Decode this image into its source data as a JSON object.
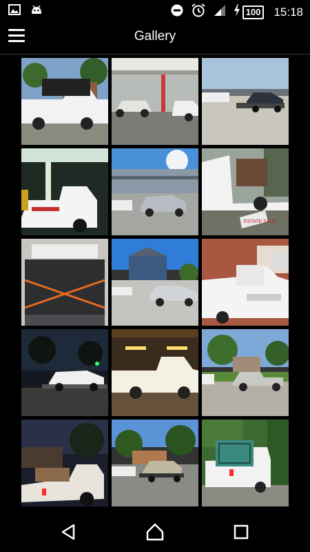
{
  "status_bar": {
    "time": "15:18",
    "battery_level": "100",
    "icons": [
      "image-notification-icon",
      "android-bot-icon",
      "do-not-disturb-icon",
      "alarm-icon",
      "signal-icon",
      "battery-charging-icon"
    ]
  },
  "app_bar": {
    "title": "Gallery",
    "menu_icon": "hamburger-menu-icon"
  },
  "gallery": {
    "columns": 3,
    "photos": [
      {
        "id": "1",
        "subject": "white pickup truck loaded with furniture in driveway"
      },
      {
        "id": "2",
        "subject": "white truck towing car at gas station"
      },
      {
        "id": "3",
        "subject": "black car on trailer in parking lot"
      },
      {
        "id": "4",
        "subject": "white Chevrolet truck at gas station at night"
      },
      {
        "id": "5",
        "subject": "truck towing SUV near apartments"
      },
      {
        "id": "6",
        "subject": "white truck with furniture and estate sale sign"
      },
      {
        "id": "7",
        "subject": "empty pickup truck bed with orange straps"
      },
      {
        "id": "8",
        "subject": "truck towing silver sedan near house"
      },
      {
        "id": "9",
        "subject": "white Chevrolet truck in front of brick building"
      },
      {
        "id": "10",
        "subject": "white car on trailer at night"
      },
      {
        "id": "11",
        "subject": "white pickup under parking garage lights"
      },
      {
        "id": "12",
        "subject": "truck towing silver pickup in neighborhood"
      },
      {
        "id": "13",
        "subject": "white truck loaded with items at dusk"
      },
      {
        "id": "14",
        "subject": "truck with flatbed trailer carrying car"
      },
      {
        "id": "15",
        "subject": "white truck carrying green cage"
      }
    ]
  },
  "nav_bar": {
    "back_icon": "back-triangle-icon",
    "home_icon": "home-icon",
    "recents_icon": "recents-square-icon"
  }
}
